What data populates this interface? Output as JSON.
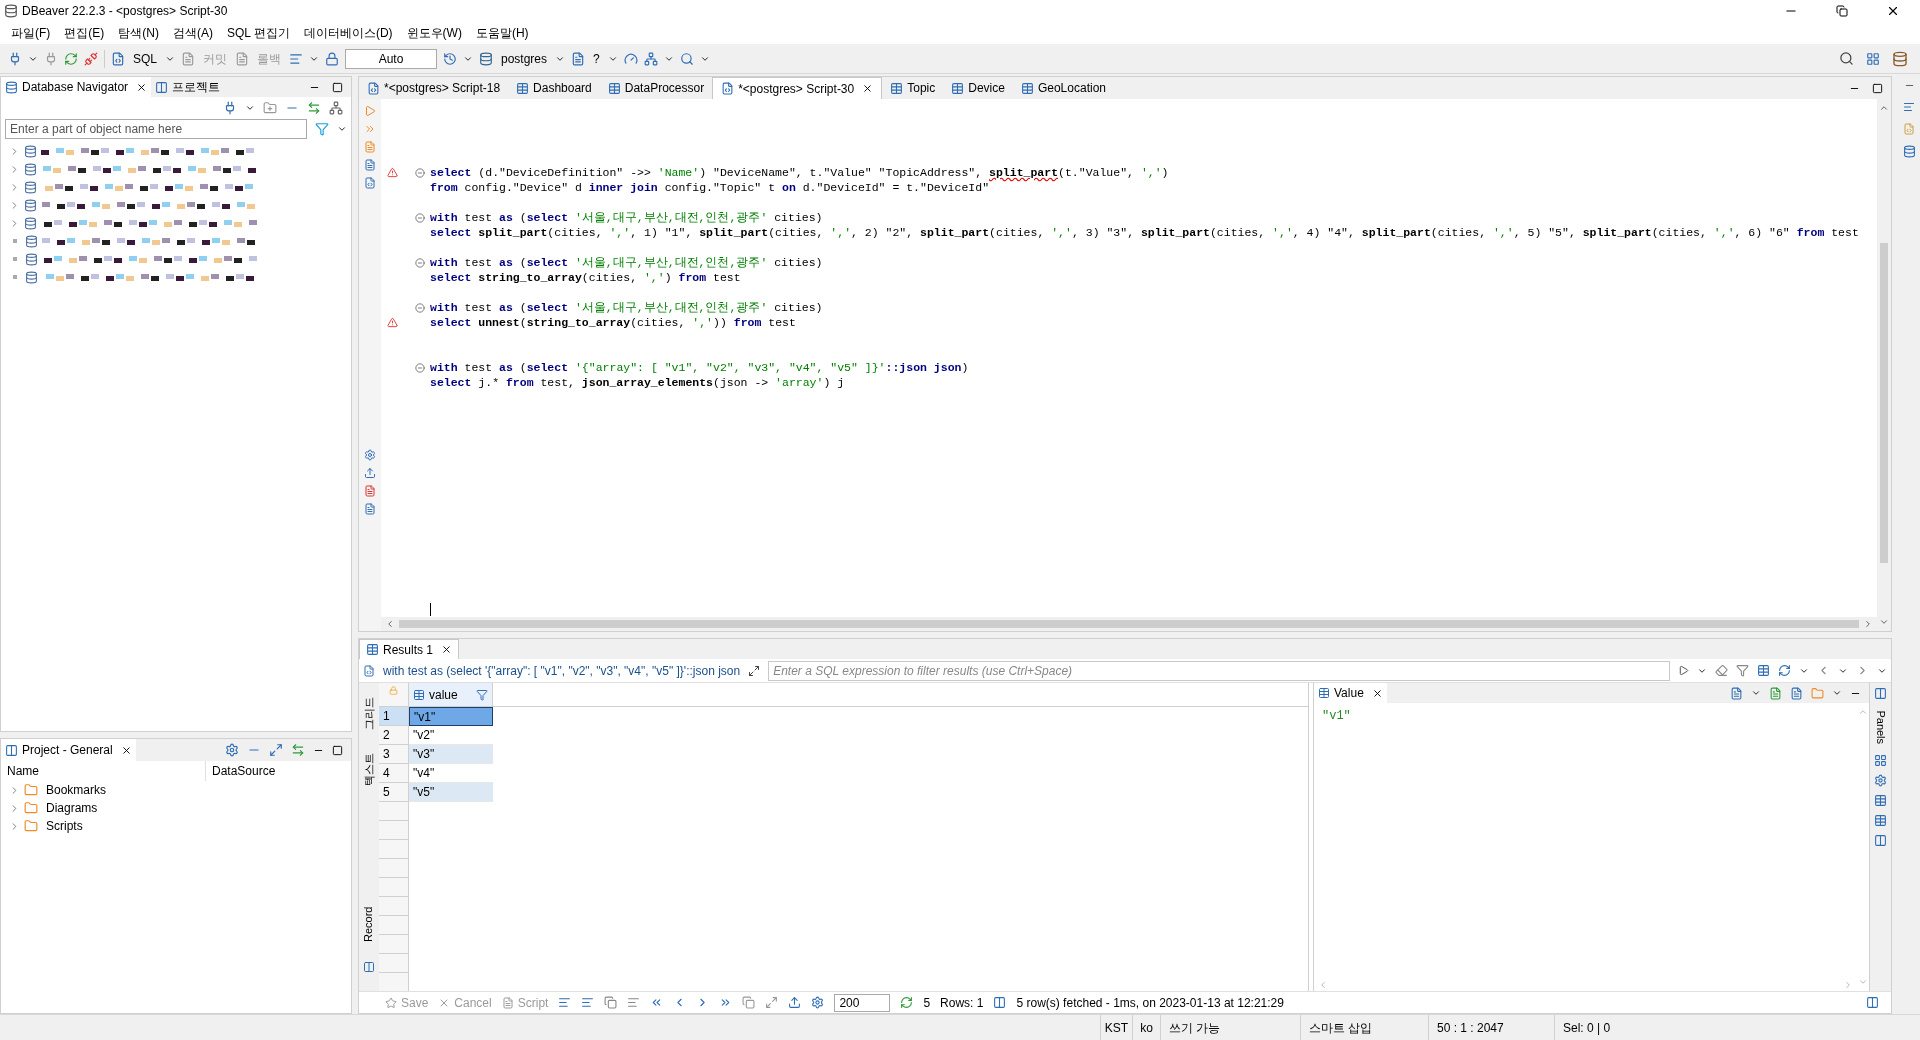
{
  "window": {
    "title": "DBeaver 22.2.3 - <postgres> Script-30"
  },
  "menu": [
    "파일(F)",
    "편집(E)",
    "탐색(N)",
    "검색(A)",
    "SQL 편집기",
    "데이터베이스(D)",
    "윈도우(W)",
    "도움말(H)"
  ],
  "toolbar": {
    "sql": "SQL",
    "commit": {
      "label": "커밋",
      "disabled": true
    },
    "rollback": {
      "label": "롤백",
      "disabled": true
    },
    "mode": "Auto",
    "datasource": "postgres",
    "schema": "?"
  },
  "navigator": {
    "tabs": [
      {
        "label": "Database Navigator",
        "selected": true
      },
      {
        "label": "프로젝트",
        "selected": false
      }
    ],
    "search": {
      "placeholder": "Enter a part of object name here"
    },
    "items": [
      {
        "expandable": true
      },
      {
        "expandable": true
      },
      {
        "expandable": true
      },
      {
        "expandable": true
      },
      {
        "expandable": true
      },
      {
        "expandable": false
      },
      {
        "expandable": false
      },
      {
        "expandable": false
      }
    ]
  },
  "project": {
    "title": "Project - General",
    "columns": [
      "Name",
      "DataSource"
    ],
    "items": [
      {
        "label": "Bookmarks"
      },
      {
        "label": "Diagrams"
      },
      {
        "label": "Scripts"
      }
    ]
  },
  "editor": {
    "tabs": [
      {
        "label": "*<postgres> Script-18",
        "selected": false
      },
      {
        "label": "Dashboard",
        "selected": false
      },
      {
        "label": "DataProcessor",
        "selected": false
      },
      {
        "label": "*<postgres> Script-30",
        "selected": true
      },
      {
        "label": "Topic",
        "selected": false
      },
      {
        "label": "Device",
        "selected": false
      },
      {
        "label": "GeoLocation",
        "selected": false
      }
    ],
    "lines": [
      {
        "kind": "code",
        "fold": true,
        "error": true,
        "tokens": [
          {
            "kind": "keyword",
            "text": "select"
          },
          {
            "kind": "plain",
            "text": " (d.\"DeviceDefinition\" ->> "
          },
          {
            "kind": "string",
            "text": "'Name'"
          },
          {
            "kind": "plain",
            "text": ") \"DeviceName\", t.\"Value\" \"TopicAddress\", "
          },
          {
            "kind": "function_error",
            "text": "split_part"
          },
          {
            "kind": "plain",
            "text": "(t.\"Value\", "
          },
          {
            "kind": "string",
            "text": "','"
          },
          {
            "kind": "plain",
            "text": ")"
          }
        ]
      },
      {
        "kind": "code",
        "fold": false,
        "error": false,
        "tokens": [
          {
            "kind": "keyword",
            "text": "from"
          },
          {
            "kind": "plain",
            "text": " config.\"Device\" d "
          },
          {
            "kind": "keyword",
            "text": "inner join"
          },
          {
            "kind": "plain",
            "text": " config.\"Topic\" t "
          },
          {
            "kind": "keyword",
            "text": "on"
          },
          {
            "kind": "plain",
            "text": " d.\"DeviceId\" = t.\"DeviceId\""
          }
        ]
      },
      {
        "kind": "blank"
      },
      {
        "kind": "code",
        "fold": true,
        "error": false,
        "tokens": [
          {
            "kind": "keyword",
            "text": "with"
          },
          {
            "kind": "plain",
            "text": " test "
          },
          {
            "kind": "keyword",
            "text": "as"
          },
          {
            "kind": "plain",
            "text": " ("
          },
          {
            "kind": "keyword",
            "text": "select "
          },
          {
            "kind": "string",
            "text": "'서울,대구,부산,대전,인천,광주'"
          },
          {
            "kind": "plain",
            "text": " cities)"
          }
        ]
      },
      {
        "kind": "code",
        "fold": false,
        "error": false,
        "tokens": [
          {
            "kind": "keyword",
            "text": "select "
          },
          {
            "kind": "function",
            "text": "split_part"
          },
          {
            "kind": "plain",
            "text": "(cities, "
          },
          {
            "kind": "string",
            "text": "','"
          },
          {
            "kind": "plain",
            "text": ", 1) \"1\", "
          },
          {
            "kind": "function",
            "text": "split_part"
          },
          {
            "kind": "plain",
            "text": "(cities, "
          },
          {
            "kind": "string",
            "text": "','"
          },
          {
            "kind": "plain",
            "text": ", 2) \"2\", "
          },
          {
            "kind": "function",
            "text": "split_part"
          },
          {
            "kind": "plain",
            "text": "(cities, "
          },
          {
            "kind": "string",
            "text": "','"
          },
          {
            "kind": "plain",
            "text": ", 3) \"3\", "
          },
          {
            "kind": "function",
            "text": "split_part"
          },
          {
            "kind": "plain",
            "text": "(cities, "
          },
          {
            "kind": "string",
            "text": "','"
          },
          {
            "kind": "plain",
            "text": ", 4) \"4\", "
          },
          {
            "kind": "function",
            "text": "split_part"
          },
          {
            "kind": "plain",
            "text": "(cities, "
          },
          {
            "kind": "string",
            "text": "','"
          },
          {
            "kind": "plain",
            "text": ", 5) \"5\", "
          },
          {
            "kind": "function",
            "text": "split_part"
          },
          {
            "kind": "plain",
            "text": "(cities, "
          },
          {
            "kind": "string",
            "text": "','"
          },
          {
            "kind": "plain",
            "text": ", 6) \"6\" "
          },
          {
            "kind": "keyword",
            "text": "from"
          },
          {
            "kind": "plain",
            "text": " test"
          }
        ]
      },
      {
        "kind": "blank"
      },
      {
        "kind": "code",
        "fold": true,
        "error": false,
        "tokens": [
          {
            "kind": "keyword",
            "text": "with"
          },
          {
            "kind": "plain",
            "text": " test "
          },
          {
            "kind": "keyword",
            "text": "as"
          },
          {
            "kind": "plain",
            "text": " ("
          },
          {
            "kind": "keyword",
            "text": "select "
          },
          {
            "kind": "string",
            "text": "'서울,대구,부산,대전,인천,광주'"
          },
          {
            "kind": "plain",
            "text": " cities)"
          }
        ]
      },
      {
        "kind": "code",
        "fold": false,
        "error": false,
        "tokens": [
          {
            "kind": "keyword",
            "text": "select "
          },
          {
            "kind": "function",
            "text": "string_to_array"
          },
          {
            "kind": "plain",
            "text": "(cities, "
          },
          {
            "kind": "string",
            "text": "','"
          },
          {
            "kind": "plain",
            "text": ") "
          },
          {
            "kind": "keyword",
            "text": "from"
          },
          {
            "kind": "plain",
            "text": " test"
          }
        ]
      },
      {
        "kind": "blank"
      },
      {
        "kind": "code",
        "fold": true,
        "error": false,
        "tokens": [
          {
            "kind": "keyword",
            "text": "with"
          },
          {
            "kind": "plain",
            "text": " test "
          },
          {
            "kind": "keyword",
            "text": "as"
          },
          {
            "kind": "plain",
            "text": " ("
          },
          {
            "kind": "keyword",
            "text": "select "
          },
          {
            "kind": "string",
            "text": "'서울,대구,부산,대전,인천,광주'"
          },
          {
            "kind": "plain",
            "text": " cities)"
          }
        ]
      },
      {
        "kind": "code",
        "fold": false,
        "error": true,
        "tokens": [
          {
            "kind": "keyword",
            "text": "select "
          },
          {
            "kind": "function",
            "text": "unnest"
          },
          {
            "kind": "plain",
            "text": "("
          },
          {
            "kind": "function",
            "text": "string_to_array"
          },
          {
            "kind": "plain",
            "text": "(cities, "
          },
          {
            "kind": "string",
            "text": "','"
          },
          {
            "kind": "plain",
            "text": ")) "
          },
          {
            "kind": "keyword",
            "text": "from"
          },
          {
            "kind": "plain",
            "text": " test"
          }
        ]
      },
      {
        "kind": "blank"
      },
      {
        "kind": "blank"
      },
      {
        "kind": "code",
        "fold": true,
        "error": false,
        "tokens": [
          {
            "kind": "keyword",
            "text": "with"
          },
          {
            "kind": "plain",
            "text": " test "
          },
          {
            "kind": "keyword",
            "text": "as"
          },
          {
            "kind": "plain",
            "text": " ("
          },
          {
            "kind": "keyword",
            "text": "select "
          },
          {
            "kind": "string",
            "text": "'{\"array\": [ \"v1\", \"v2\", \"v3\", \"v4\", \"v5\" ]}'"
          },
          {
            "kind": "keyword",
            "text": "::json json"
          },
          {
            "kind": "plain",
            "text": ")"
          }
        ]
      },
      {
        "kind": "code",
        "fold": false,
        "error": false,
        "tokens": [
          {
            "kind": "keyword",
            "text": "select"
          },
          {
            "kind": "plain",
            "text": " j.* "
          },
          {
            "kind": "keyword",
            "text": "from"
          },
          {
            "kind": "plain",
            "text": " test, "
          },
          {
            "kind": "function",
            "text": "json_array_elements"
          },
          {
            "kind": "plain",
            "text": "(json -> "
          },
          {
            "kind": "string",
            "text": "'array'"
          },
          {
            "kind": "plain",
            "text": ") j"
          }
        ]
      }
    ]
  },
  "results": {
    "tabs": [
      {
        "label": "Results 1",
        "selected": true
      }
    ],
    "query": "with test as (select '{\"array\": [ \"v1\", \"v2\", \"v3\", \"v4\", \"v5\" ]}'::json json",
    "filter_placeholder": "Enter a SQL expression to filter results (use Ctrl+Space)",
    "column": "value",
    "rows": [
      {
        "number": "1",
        "value": "\"v1\"",
        "selected": true
      },
      {
        "number": "2",
        "value": "\"v2\"",
        "selected": false
      },
      {
        "number": "3",
        "value": "\"v3\"",
        "selected": false
      },
      {
        "number": "4",
        "value": "\"v4\"",
        "selected": false
      },
      {
        "number": "5",
        "value": "\"v5\"",
        "selected": false
      }
    ],
    "side_tabs": [
      "그리드",
      "텍스트"
    ],
    "record": "Record",
    "value_panel": {
      "title": "Value",
      "content": "\"v1\""
    },
    "panels_label": "Panels",
    "bottom": {
      "save": {
        "label": "Save",
        "disabled": true
      },
      "cancel": {
        "label": "Cancel",
        "disabled": true
      },
      "script": {
        "label": "Script",
        "disabled": true
      },
      "fetch_size": "200",
      "fetch_count": "5",
      "rows": "Rows: 1",
      "message": "5 row(s) fetched - 1ms, on 2023-01-13 at 12:21:29"
    }
  },
  "status_bar": [
    "KST",
    "ko",
    "쓰기 가능",
    "스마트 삽입",
    "50 : 1 : 2047",
    "Sel: 0 | 0"
  ]
}
